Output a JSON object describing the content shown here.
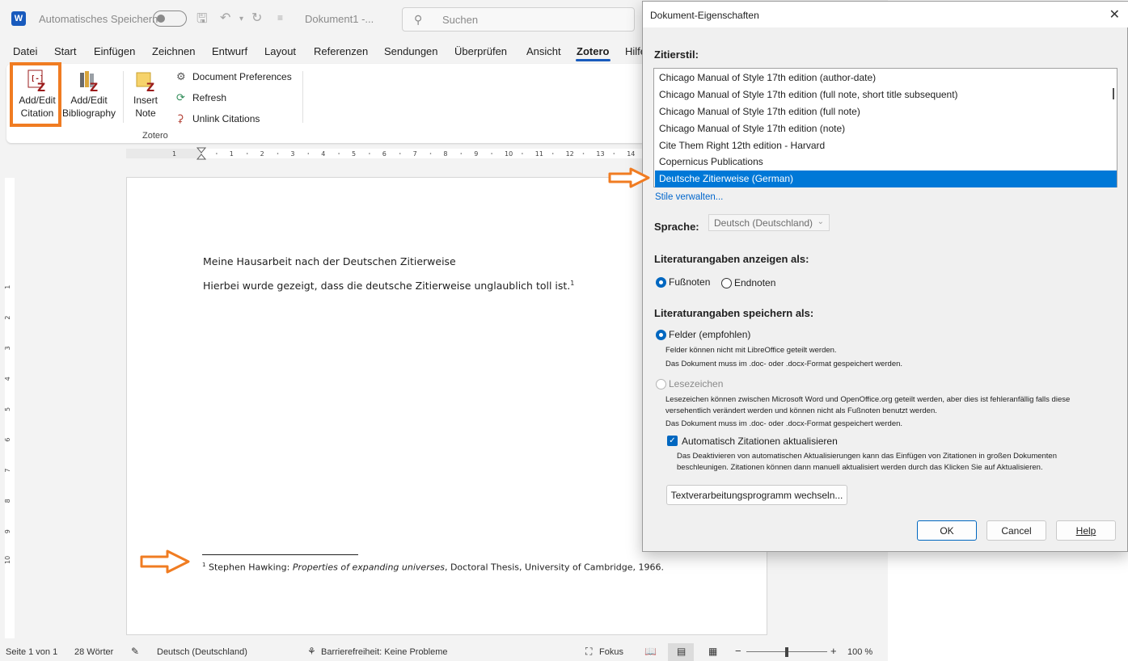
{
  "word": {
    "logo_letter": "W",
    "autosave_label": "Automatisches Speichern",
    "document_title": "Dokument1 -...",
    "search_placeholder": "Suchen",
    "menu": [
      "Datei",
      "Start",
      "Einfügen",
      "Zeichnen",
      "Entwurf",
      "Layout",
      "Referenzen",
      "Sendungen",
      "Überprüfen",
      "Ansicht",
      "Zotero",
      "Hilfe"
    ],
    "active_menu": "Zotero",
    "ribbon": {
      "add_edit_citation": [
        "Add/Edit",
        "Citation"
      ],
      "add_edit_bibliography": [
        "Add/Edit",
        "Bibliography"
      ],
      "insert_note": [
        "Insert",
        "Note"
      ],
      "document_preferences": "Document Preferences",
      "refresh": "Refresh",
      "unlink_citations": "Unlink Citations",
      "group_label": "Zotero"
    },
    "ruler_numbers": [
      "1",
      "2",
      "3",
      "4",
      "5",
      "6",
      "7",
      "8",
      "9",
      "10",
      "11",
      "12",
      "13",
      "14"
    ],
    "vruler_numbers": [
      "1",
      "2",
      "3",
      "4",
      "5",
      "6",
      "7",
      "8",
      "9",
      "10"
    ],
    "document": {
      "heading": "Meine Hausarbeit nach der Deutschen Zitierweise",
      "paragraph": "Hierbei wurde gezeigt, dass die deutsche Zitierweise unglaublich toll ist.",
      "footnote_marker": "1",
      "footnote_number": "1",
      "footnote_author": "Stephen Hawking: ",
      "footnote_title": "Properties of expanding universes",
      "footnote_rest": ", Doctoral Thesis, University of Cambridge, 1966."
    },
    "status": {
      "page": "Seite 1 von 1",
      "words": "28 Wörter",
      "language": "Deutsch (Deutschland)",
      "accessibility": "Barrierefreiheit: Keine Probleme",
      "focus": "Fokus",
      "zoom": "100 %",
      "zoom_minus": "−",
      "zoom_plus": "+"
    }
  },
  "dialog": {
    "title": "Dokument-Eigenschaften",
    "close_glyph": "✕",
    "citation_style_label": "Zitierstil:",
    "styles": [
      "Chicago Manual of Style 17th edition (author-date)",
      "Chicago Manual of Style 17th edition (full note, short title subsequent)",
      "Chicago Manual of Style 17th edition (full note)",
      "Chicago Manual of Style 17th edition (note)",
      "Cite Them Right 12th edition - Harvard",
      "Copernicus Publications",
      "Deutsche Zitierweise (German)"
    ],
    "selected_style": "Deutsche Zitierweise (German)",
    "manage_styles": "Stile verwalten...",
    "language_label": "Sprache:",
    "language_value": "Deutsch (Deutschland)",
    "display_as_label": "Literaturangaben anzeigen als:",
    "footnotes": "Fußnoten",
    "endnotes": "Endnoten",
    "store_as_label": "Literaturangaben speichern als:",
    "fields": "Felder (empfohlen)",
    "fields_hint_1": "Felder können nicht mit LibreOffice geteilt werden.",
    "fields_hint_2": "Das Dokument muss im .doc- oder .docx-Format gespeichert werden.",
    "bookmarks": "Lesezeichen",
    "bookmarks_hint_1": "Lesezeichen können zwischen Microsoft Word und OpenOffice.org geteilt werden, aber dies ist fehleranfällig falls diese",
    "bookmarks_hint_2": "versehentlich verändert werden und können nicht als Fußnoten benutzt werden.",
    "bookmarks_hint_3": "Das Dokument muss im .doc- oder .docx-Format gespeichert werden.",
    "auto_update": "Automatisch Zitationen aktualisieren",
    "auto_update_hint_1": "Das Deaktivieren von automatischen Aktualisierungen kann das Einfügen von Zitationen in großen Dokumenten",
    "auto_update_hint_2": "beschleunigen. Zitationen können dann manuell aktualisiert werden durch das Klicken Sie auf Aktualisieren.",
    "switch_processor": "Textverarbeitungsprogramm wechseln...",
    "ok": "OK",
    "cancel": "Cancel",
    "help": "Help"
  },
  "colors": {
    "accent": "#0078d7",
    "highlight": "#f07c22",
    "word_blue": "#185abd"
  }
}
